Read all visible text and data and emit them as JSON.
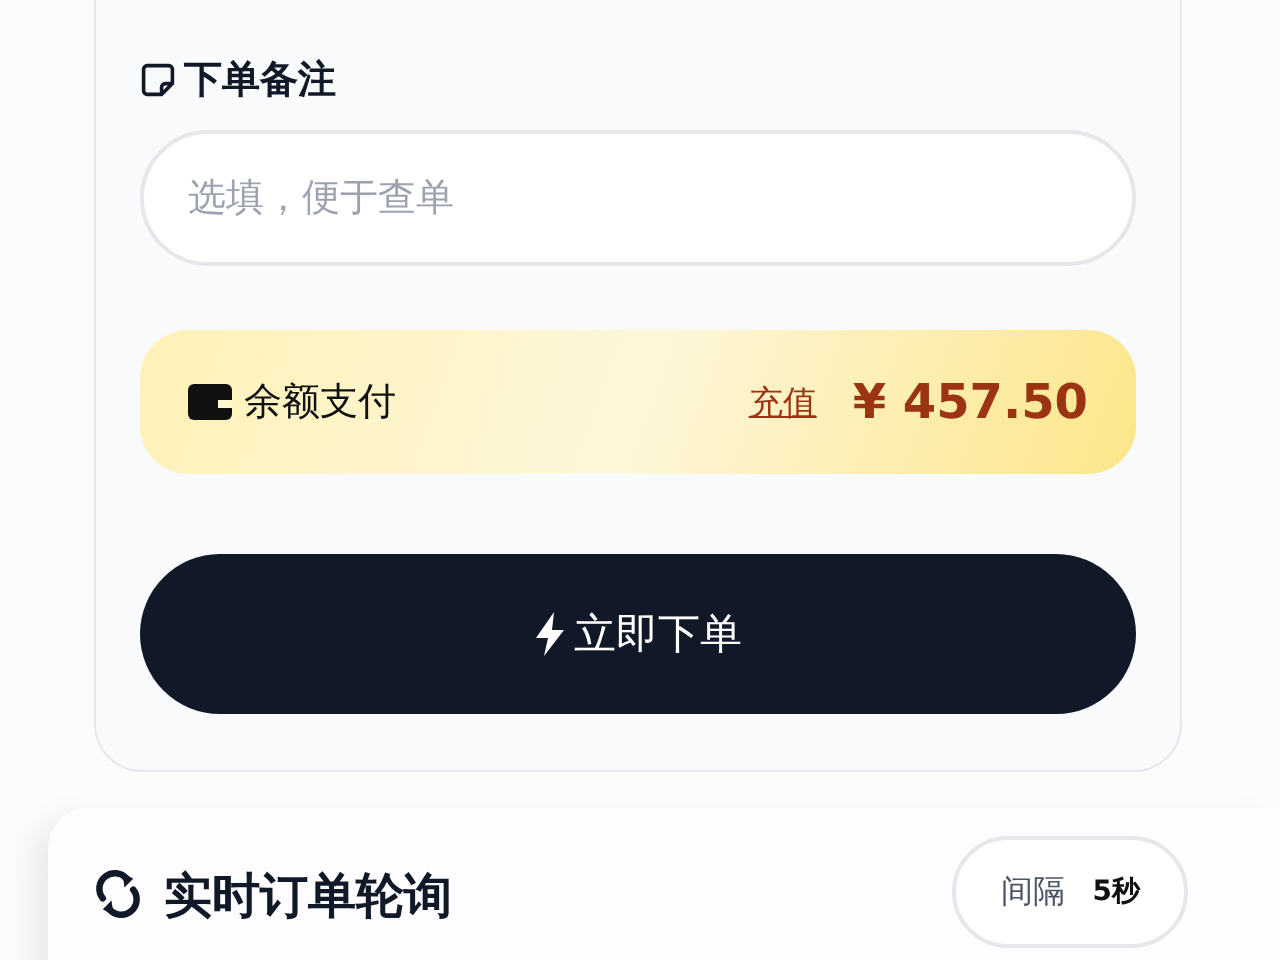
{
  "remark": {
    "label": "下单备注",
    "placeholder": "选填，便于查单"
  },
  "payment": {
    "label": "余额支付",
    "recharge": "充值",
    "balance": "¥ 457.50"
  },
  "submit": {
    "label": "立即下单"
  },
  "polling": {
    "title": "实时订单轮询",
    "interval_label": "间隔",
    "interval_value": "5秒"
  }
}
